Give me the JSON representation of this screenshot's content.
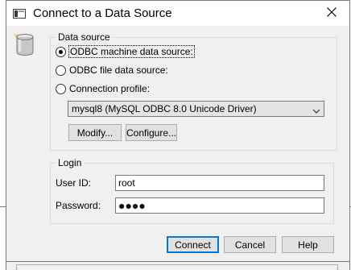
{
  "window": {
    "title": "Connect to a Data Source",
    "app_icon": "dialog-app-icon",
    "close_icon": "close-icon"
  },
  "icons": {
    "database": "database-icon"
  },
  "data_source": {
    "group_label": "Data source",
    "options": [
      {
        "label": "ODBC machine data source:",
        "checked": true
      },
      {
        "label": "ODBC file data source:",
        "checked": false
      },
      {
        "label": "Connection profile:",
        "checked": false
      }
    ],
    "profile_select_value": "mysql8 (MySQL ODBC 8.0 Unicode Driver)",
    "modify_label": "Modify...",
    "configure_label": "Configure..."
  },
  "login": {
    "group_label": "Login",
    "user_id_label": "User ID:",
    "user_id_value": "root",
    "password_label": "Password:",
    "password_value": "●●●●"
  },
  "actions": {
    "connect_label": "Connect",
    "cancel_label": "Cancel",
    "help_label": "Help"
  },
  "colors": {
    "dialog_bg": "#f0f0f0",
    "accent": "#0078d7"
  }
}
